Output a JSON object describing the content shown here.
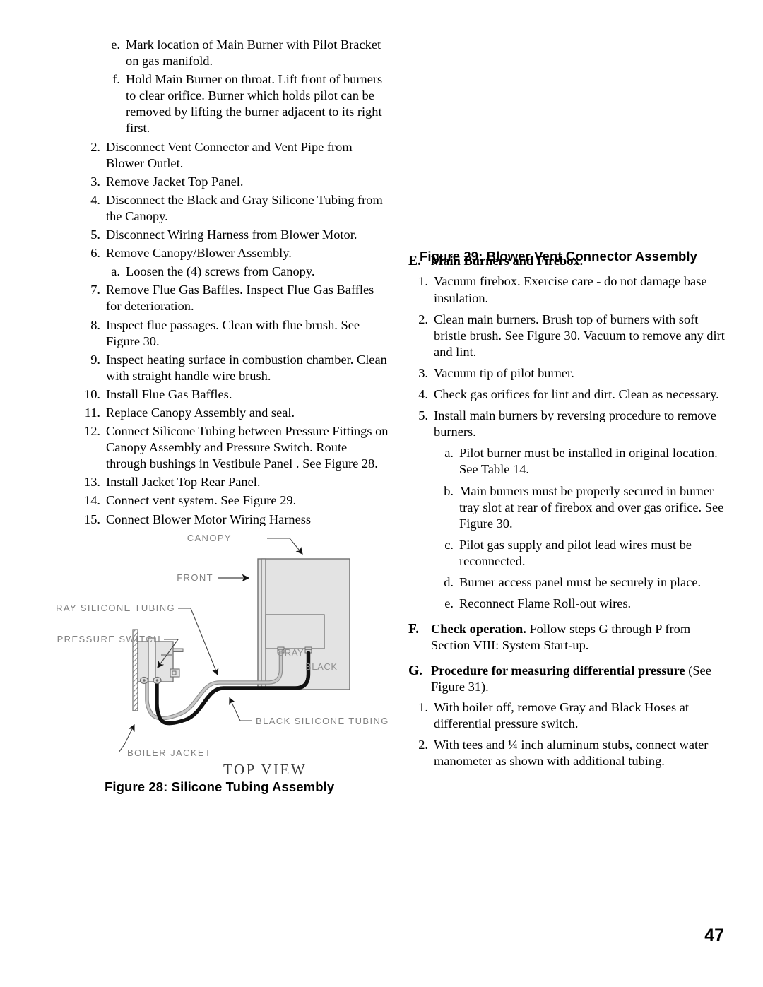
{
  "page": {
    "number": "47"
  },
  "left_column": {
    "items": [
      {
        "marker": "e.",
        "level": "alpha",
        "text": "Mark location of Main Burner with Pilot Bracket on gas manifold."
      },
      {
        "marker": "f.",
        "level": "alpha",
        "text": "Hold Main Burner on throat.  Lift front of burners to clear orifice.  Burner which holds pilot can be removed by lifting the burner adjacent to its right first."
      },
      {
        "marker": "2.",
        "level": "num",
        "text": "Disconnect Vent Connector and Vent Pipe from Blower Outlet."
      },
      {
        "marker": "3.",
        "level": "num",
        "text": "Remove Jacket Top Panel."
      },
      {
        "marker": "4.",
        "level": "num",
        "text": "Disconnect the Black and Gray Silicone Tubing from the Canopy."
      },
      {
        "marker": "5.",
        "level": "num",
        "text": "Disconnect Wiring Harness from Blower Motor."
      },
      {
        "marker": "6.",
        "level": "num",
        "text": "Remove Canopy/Blower Assembly."
      },
      {
        "marker": "a.",
        "level": "alpha",
        "text": "Loosen the (4) screws from Canopy."
      },
      {
        "marker": "7.",
        "level": "num",
        "text": "Remove Flue Gas Baffles.  Inspect Flue Gas Baffles for deterioration."
      },
      {
        "marker": "8.",
        "level": "num",
        "text": "Inspect flue passages.  Clean with flue brush.  See Figure 30."
      },
      {
        "marker": "9.",
        "level": "num",
        "text": "Inspect heating surface in combustion chamber. Clean with straight handle wire brush."
      },
      {
        "marker": "10.",
        "level": "num",
        "text": "Install Flue Gas Baffles."
      },
      {
        "marker": "11.",
        "level": "num",
        "text": "Replace Canopy Assembly and seal."
      },
      {
        "marker": "12.",
        "level": "num",
        "text": "Connect Silicone Tubing between Pressure Fittings on Canopy Assembly and Pressure Switch.  Route through bushings in Vestibule Panel .  See Figure 28."
      },
      {
        "marker": "13.",
        "level": "num",
        "text": "Install Jacket Top Rear Panel."
      },
      {
        "marker": "14.",
        "level": "num",
        "text": "Connect vent system.  See Figure 29."
      },
      {
        "marker": "15.",
        "level": "num",
        "text": "Connect Blower Motor Wiring Harness"
      }
    ]
  },
  "right_column": {
    "figure29_caption": "Figure 29:  Blower Vent Connector Assembly",
    "sections": [
      {
        "marker": "E.",
        "heading_bold": "Main Burners and Firebox.",
        "heading_rest": "",
        "items": [
          {
            "marker": "1.",
            "level": "num",
            "text": "Vacuum firebox. Exercise care - do not damage base insulation."
          },
          {
            "marker": "2.",
            "level": "num",
            "text": "Clean main burners. Brush top of  burners with soft bristle brush. See Figure 30. Vacuum to remove any dirt and lint."
          },
          {
            "marker": "3.",
            "level": "num",
            "text": "Vacuum tip of pilot burner."
          },
          {
            "marker": "4.",
            "level": "num",
            "text": "Check gas orifices for lint and dirt. Clean as necessary."
          },
          {
            "marker": "5.",
            "level": "num",
            "text": "Install main burners by reversing procedure to remove burners."
          },
          {
            "marker": "a.",
            "level": "alpha",
            "text": "Pilot burner must be installed in original location. See Table 14."
          },
          {
            "marker": "b.",
            "level": "alpha",
            "text": "Main burners must be properly secured in burner tray slot at rear of firebox and over gas orifice. See Figure 30."
          },
          {
            "marker": "c.",
            "level": "alpha",
            "text": "Pilot gas supply and pilot lead wires must be reconnected."
          },
          {
            "marker": "d.",
            "level": "alpha",
            "text": "Burner access panel must be securely in place."
          },
          {
            "marker": "e.",
            "level": "alpha",
            "text": "Reconnect Flame Roll-out wires."
          }
        ]
      },
      {
        "marker": "F.",
        "heading_bold": "Check operation.",
        "heading_rest": " Follow steps G through P from Section VIII: System Start-up.",
        "items": []
      },
      {
        "marker": "G.",
        "heading_bold": "Procedure for measuring differential pressure",
        "heading_rest": " (See Figure 31).",
        "items": [
          {
            "marker": "1.",
            "level": "num",
            "text": "With boiler off, remove Gray and Black Hoses at differential pressure switch."
          },
          {
            "marker": "2.",
            "level": "num",
            "text": "With tees and ¼ inch aluminum stubs, connect water manometer as shown with additional tubing."
          }
        ]
      }
    ]
  },
  "figure28": {
    "caption": "Figure 28:  Silicone Tubing Assembly",
    "view_label": "TOP  VIEW",
    "labels": {
      "canopy": "CANOPY",
      "front": "FRONT",
      "gray_silicone_tubing": "GRAY  SILICONE  TUBING",
      "pressure_switch": "PRESSURE  SWITCH",
      "boiler_jacket": "BOILER  JACKET",
      "black_silicone_tubing": "BLACK  SILICONE  TUBING",
      "gray": "GRAY",
      "black": "BLACK"
    },
    "colors": {
      "label_text": "#808080",
      "body_fill": "#e3e3e3",
      "body_stroke": "#6e6e6e",
      "gray_tube": "#a8a8a8",
      "black_tube": "#111111",
      "leader_line": "#444444"
    }
  }
}
